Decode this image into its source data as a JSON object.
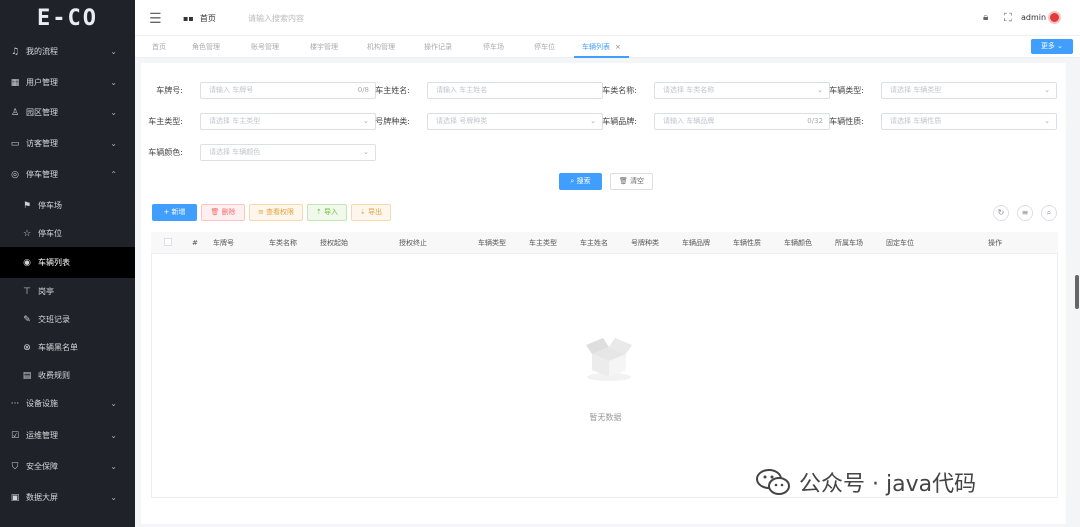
{
  "app": {
    "logo": "E-CO"
  },
  "sidebar": {
    "items": [
      {
        "label": "我的流程",
        "icon": "bell-icon",
        "glyph": "♫",
        "chev": "⌄"
      },
      {
        "label": "用户管理",
        "icon": "grid-icon",
        "glyph": "▦",
        "chev": "⌄"
      },
      {
        "label": "园区管理",
        "icon": "user-icon",
        "glyph": "♙",
        "chev": "⌄"
      },
      {
        "label": "访客管理",
        "icon": "monitor-icon",
        "glyph": "▭",
        "chev": "⌄"
      },
      {
        "label": "停车管理",
        "icon": "compass-icon",
        "glyph": "◎",
        "chev": "⌃"
      },
      {
        "label": "停车场",
        "icon": "flag-icon",
        "glyph": "⚑"
      },
      {
        "label": "停车位",
        "icon": "star-icon",
        "glyph": "☆"
      },
      {
        "label": "车辆列表",
        "icon": "location-icon",
        "glyph": "◉"
      },
      {
        "label": "岗亭",
        "icon": "booth-icon",
        "glyph": "⊤"
      },
      {
        "label": "交班记录",
        "icon": "edit-icon",
        "glyph": "✎"
      },
      {
        "label": "车辆黑名单",
        "icon": "block-icon",
        "glyph": "⊗"
      },
      {
        "label": "收费规则",
        "icon": "table-icon",
        "glyph": "▤"
      },
      {
        "label": "设备设施",
        "icon": "dots-icon",
        "glyph": "···",
        "chev": "⌄"
      },
      {
        "label": "运维管理",
        "icon": "checklist-icon",
        "glyph": "☑",
        "chev": "⌄"
      },
      {
        "label": "安全保障",
        "icon": "shield-icon",
        "glyph": "⛉",
        "chev": "⌄"
      },
      {
        "label": "数据大屏",
        "icon": "dashboard-icon",
        "glyph": "▣",
        "chev": "⌄"
      }
    ]
  },
  "topbar": {
    "home": "首页",
    "search_placeholder": "请输入搜索内容",
    "username": "admin"
  },
  "tabs": [
    "首页",
    "角色管理",
    "账号管理",
    "楼宇管理",
    "机构管理",
    "操作记录",
    "停车场",
    "停车位",
    "车辆列表"
  ],
  "more_label": "更多",
  "filters": {
    "plate": {
      "label": "车牌号:",
      "placeholder": "请输入 车牌号",
      "counter": "0/8"
    },
    "owner": {
      "label": "车主姓名:",
      "placeholder": "请输入 车主姓名"
    },
    "category": {
      "label": "车类名称:",
      "placeholder": "请选择 车类名称"
    },
    "car_type": {
      "label": "车辆类型:",
      "placeholder": "请选择 车辆类型"
    },
    "owner_type": {
      "label": "车主类型:",
      "placeholder": "请选择 车主类型"
    },
    "plate_kind": {
      "label": "号牌种类:",
      "placeholder": "请选择 号牌种类"
    },
    "brand": {
      "label": "车辆品牌:",
      "placeholder": "请输入 车辆品牌",
      "counter": "0/32"
    },
    "nature": {
      "label": "车辆性质:",
      "placeholder": "请选择 车辆性质"
    },
    "color": {
      "label": "车辆颜色:",
      "placeholder": "请选择 车辆颜色"
    }
  },
  "actions": {
    "search": "搜索",
    "clear": "清空"
  },
  "toolbar": {
    "add": "新增",
    "delete": "删除",
    "auth": "查看权限",
    "import": "导入",
    "export": "导出"
  },
  "table": {
    "headers": [
      "#",
      "车牌号",
      "车类名称",
      "授权起始",
      "授权终止",
      "车辆类型",
      "车主类型",
      "车主姓名",
      "号牌种类",
      "车辆品牌",
      "车辆性质",
      "车辆颜色",
      "所属车场",
      "固定车位",
      "操作"
    ],
    "empty_text": "暂无数据"
  },
  "watermark": "公众号 · java代码",
  "colors": {
    "primary": "#409eff",
    "sidebar_bg": "#1f2329",
    "danger": "#f56c6c",
    "warning": "#e6a23c",
    "success": "#67c23a"
  }
}
